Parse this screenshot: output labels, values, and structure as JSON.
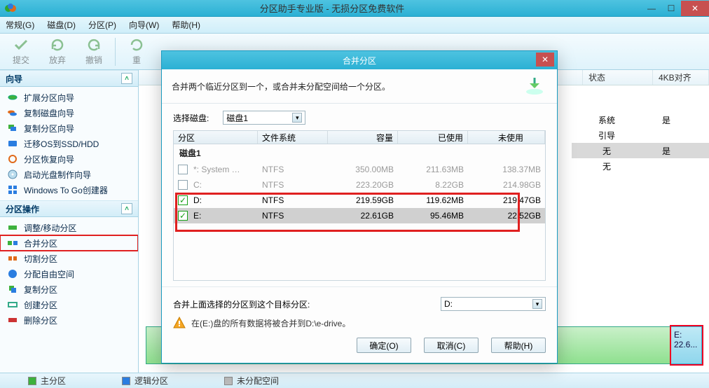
{
  "window": {
    "title": "分区助手专业版 - 无损分区免费软件"
  },
  "menu": {
    "items": [
      "常规(G)",
      "磁盘(D)",
      "分区(P)",
      "向导(W)",
      "帮助(H)"
    ]
  },
  "toolbar": {
    "commit": "提交",
    "discard": "放弃",
    "undo": "撤销",
    "redo": "重"
  },
  "sidebar": {
    "wizard": {
      "title": "向导",
      "items": [
        "扩展分区向导",
        "复制磁盘向导",
        "复制分区向导",
        "迁移OS到SSD/HDD",
        "分区恢复向导",
        "启动光盘制作向导",
        "Windows To Go创建器"
      ]
    },
    "ops": {
      "title": "分区操作",
      "items": [
        "调整/移动分区",
        "合并分区",
        "切割分区",
        "分配自由空间",
        "复制分区",
        "创建分区",
        "删除分区"
      ]
    }
  },
  "grid": {
    "cols": {
      "state": "状态",
      "align": "4KB对齐"
    },
    "rows": [
      {
        "state": "系统",
        "align": "是"
      },
      {
        "state": "引导",
        "align": ""
      },
      {
        "state": "无",
        "align": "是"
      },
      {
        "state": "无",
        "align": ""
      }
    ]
  },
  "disk_e": {
    "label": "E:",
    "size": "22.6..."
  },
  "status": {
    "primary": "主分区",
    "logical": "逻辑分区",
    "unalloc": "未分配空间"
  },
  "dialog": {
    "title": "合并分区",
    "desc": "合并两个临近分区到一个，或合并未分配空间给一个分区。",
    "select_disk_label": "选择磁盘:",
    "disk_value": "磁盘1",
    "cols": {
      "part": "分区",
      "fs": "文件系统",
      "cap": "容量",
      "used": "已使用",
      "free": "未使用"
    },
    "diskgroup": "磁盘1",
    "rows": [
      {
        "checked": false,
        "dim": true,
        "part": "*: System …",
        "fs": "NTFS",
        "cap": "350.00MB",
        "used": "211.63MB",
        "free": "138.37MB"
      },
      {
        "checked": false,
        "dim": true,
        "part": "C:",
        "fs": "NTFS",
        "cap": "223.20GB",
        "used": "8.22GB",
        "free": "214.98GB"
      },
      {
        "checked": true,
        "dim": false,
        "part": "D:",
        "fs": "NTFS",
        "cap": "219.59GB",
        "used": "119.62MB",
        "free": "219.47GB"
      },
      {
        "checked": true,
        "dim": false,
        "part": "E:",
        "fs": "NTFS",
        "cap": "22.61GB",
        "used": "95.46MB",
        "free": "22.52GB"
      }
    ],
    "target_label": "合并上面选择的分区到这个目标分区:",
    "target_value": "D:",
    "warning": "在(E:)盘的所有数据将被合并到D:\\e-drive。",
    "buttons": {
      "ok": "确定(O)",
      "cancel": "取消(C)",
      "help": "帮助(H)"
    }
  }
}
